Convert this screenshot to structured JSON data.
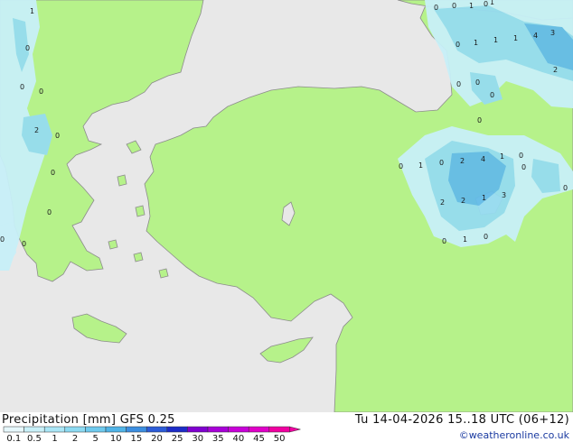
{
  "map": {
    "title_left": "Precipitation [mm]  GFS 0.25",
    "valid_time": "Tu 14-04-2026 15..18 UTC (06+12)",
    "credit": "©weatheronline.co.uk",
    "colors": {
      "sea": "#e8e8e8",
      "land": "#b6f28a",
      "coast": "#8c8c8c",
      "precip_light": "#c8f0f8",
      "precip_medium": "#96dcf0",
      "precip_heavy": "#64bce8"
    },
    "legend": {
      "labels": [
        "0.1",
        "0.5",
        "1",
        "2",
        "5",
        "10",
        "15",
        "20",
        "25",
        "30",
        "35",
        "40",
        "45",
        "50"
      ],
      "colors": [
        "#e6f8fc",
        "#c8f0f8",
        "#aae6f6",
        "#8cdaf2",
        "#6ecaee",
        "#50b4e8",
        "#3c8ee0",
        "#2c5cd8",
        "#1c2cc8",
        "#8000d0",
        "#a800d8",
        "#c800d8",
        "#e000c8",
        "#f000a0"
      ]
    },
    "values": [
      {
        "text": "1"
      },
      {
        "text": "0"
      },
      {
        "text": "0"
      },
      {
        "text": "0"
      },
      {
        "text": "2"
      },
      {
        "text": "0"
      },
      {
        "text": "0"
      },
      {
        "text": "0"
      },
      {
        "text": "0"
      },
      {
        "text": "0"
      },
      {
        "text": "0"
      },
      {
        "text": "0"
      },
      {
        "text": "1"
      },
      {
        "text": "0"
      },
      {
        "text": "1"
      },
      {
        "text": "0"
      },
      {
        "text": "1"
      },
      {
        "text": "1"
      },
      {
        "text": "1"
      },
      {
        "text": "4"
      },
      {
        "text": "3"
      },
      {
        "text": "2"
      },
      {
        "text": "0"
      },
      {
        "text": "0"
      },
      {
        "text": "0"
      },
      {
        "text": "0"
      },
      {
        "text": "0"
      },
      {
        "text": "1"
      },
      {
        "text": "0"
      },
      {
        "text": "2"
      },
      {
        "text": "4"
      },
      {
        "text": "1"
      },
      {
        "text": "0"
      },
      {
        "text": "0"
      },
      {
        "text": "0"
      },
      {
        "text": "2"
      },
      {
        "text": "2"
      },
      {
        "text": "1"
      },
      {
        "text": "3"
      },
      {
        "text": "0"
      },
      {
        "text": "1"
      },
      {
        "text": "0"
      }
    ]
  }
}
